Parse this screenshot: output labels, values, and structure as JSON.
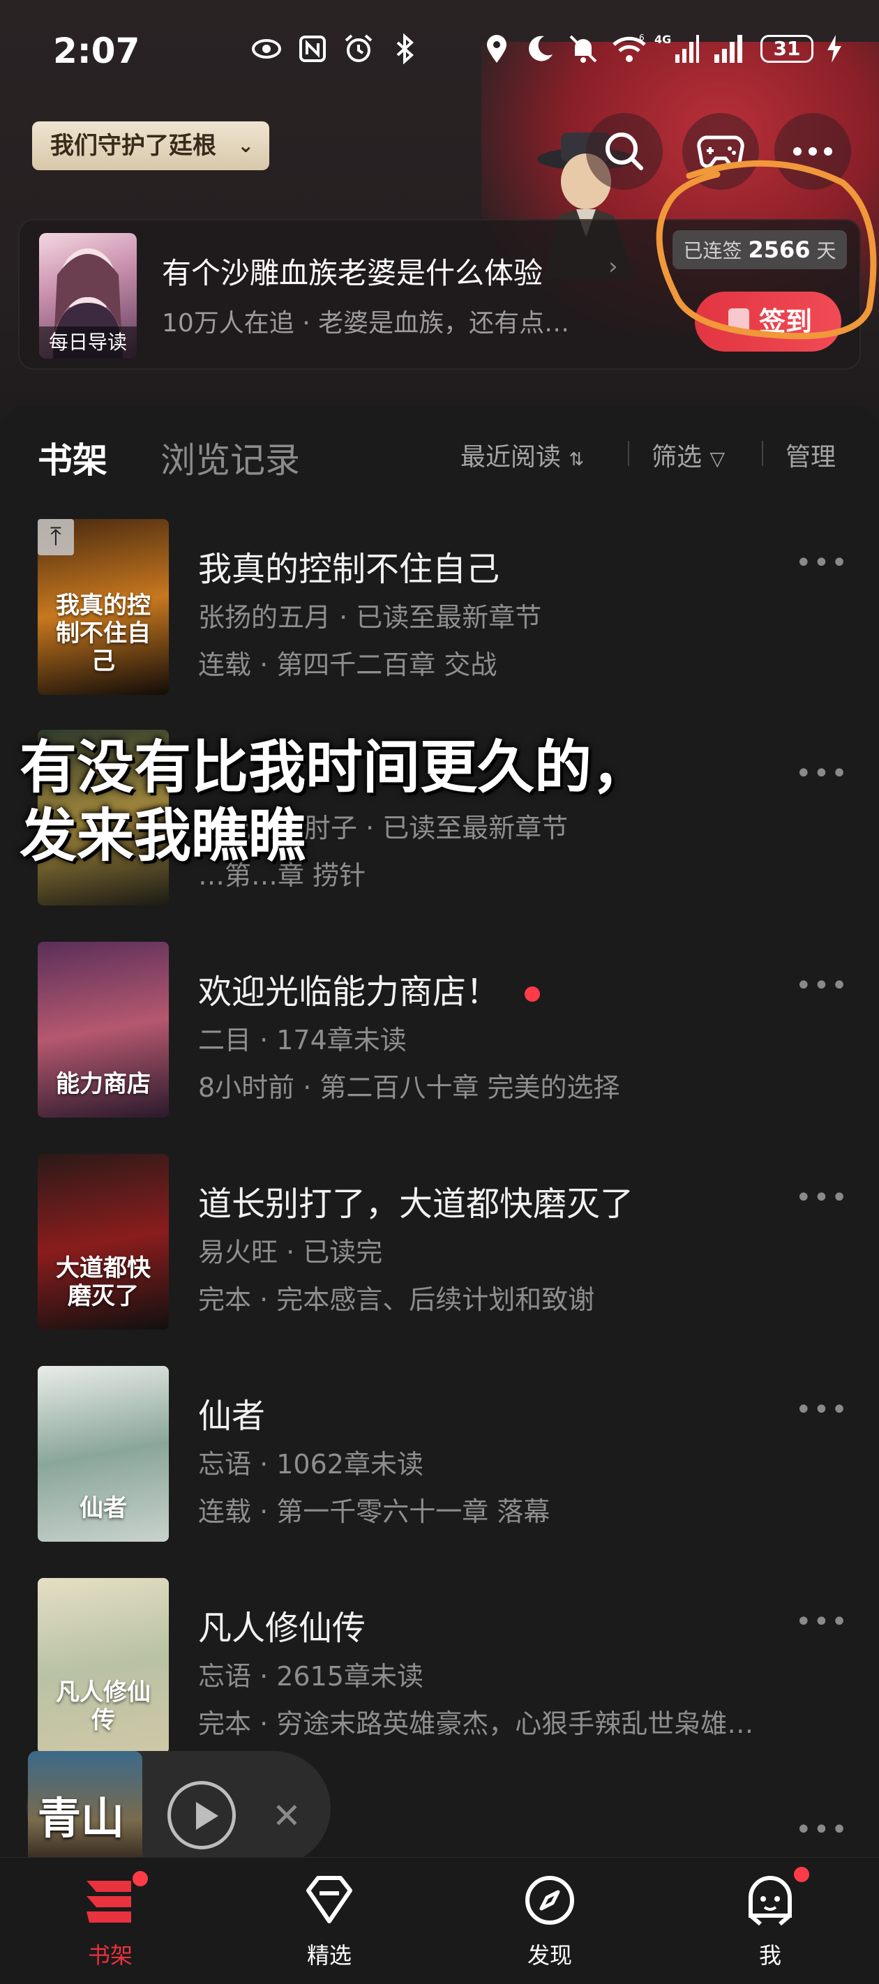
{
  "status": {
    "time": "2:07",
    "battery": "31",
    "network_label": "4G",
    "wifi_badge": "6"
  },
  "header": {
    "guard_chip": "我们守护了廷根",
    "icons": [
      "search-icon",
      "gamepad-icon",
      "more-icon"
    ]
  },
  "daily": {
    "cover_label": "每日导读",
    "title": "有个沙雕血族老婆是什么体验",
    "meta": "10万人在追 · 老婆是血族，还有点…",
    "streak_prefix": "已连签",
    "streak_days": "2566",
    "streak_suffix": "天",
    "checkin_label": "签到"
  },
  "shelf": {
    "tabs": [
      "书架",
      "浏览记录"
    ],
    "sort_label": "最近阅读",
    "filter_label": "筛选",
    "manage_label": "管理"
  },
  "books": [
    {
      "title": "我真的控制不住自己",
      "line2": "张扬的五月 · 已读至最新章节",
      "line3": "连载 · 第四千二百章 交战",
      "cover_text": "我真的控制不住自己",
      "pinned": true,
      "new": false,
      "colors": [
        "#4a2a10",
        "#c7781f",
        "#120c08"
      ]
    },
    {
      "title": "",
      "line2": "会说话的肘子 · 已读至最新章节",
      "line3": "…第…章 捞针",
      "cover_text": "",
      "pinned": false,
      "new": false,
      "colors": [
        "#2d3a2c",
        "#a58a3d",
        "#1b1a14"
      ]
    },
    {
      "title": "欢迎光临能力商店！",
      "line2": "二目 · 174章未读",
      "line3": "8小时前 · 第二百八十章 完美的选择",
      "cover_text": "能力商店",
      "pinned": false,
      "new": true,
      "colors": [
        "#5a2f5a",
        "#b5586f",
        "#2b1a2c"
      ]
    },
    {
      "title": "道长别打了，大道都快磨灭了",
      "line2": "易火旺 · 已读完",
      "line3": "完本 · 完本感言、后续计划和致谢",
      "cover_text": "大道都快磨灭了",
      "pinned": false,
      "new": false,
      "colors": [
        "#2a1a18",
        "#8a1d1d",
        "#121010"
      ]
    },
    {
      "title": "仙者",
      "line2": "忘语 · 1062章未读",
      "line3": "连载 · 第一千零六十一章 落幕",
      "cover_text": "仙者",
      "pinned": false,
      "new": false,
      "colors": [
        "#e9ece8",
        "#8aa69a",
        "#c8d2cc"
      ]
    },
    {
      "title": "凡人修仙传",
      "line2": "忘语 · 2615章未读",
      "line3": "完本 · 穷途末路英雄豪杰，心狠手辣乱世枭雄…",
      "cover_text": "凡人修仙传",
      "pinned": false,
      "new": false,
      "colors": [
        "#e5dfc4",
        "#b9c2a4",
        "#cfc8a6"
      ]
    }
  ],
  "overlay_caption": [
    "有没有比我时间更久的，",
    "发来我瞧瞧"
  ],
  "mini_player": {
    "cover_text": "青山"
  },
  "nav": [
    {
      "label": "书架",
      "icon": "bookshelf-icon",
      "active": true
    },
    {
      "label": "精选",
      "icon": "diamond-icon",
      "active": false
    },
    {
      "label": "发现",
      "icon": "compass-icon",
      "active": false
    },
    {
      "label": "我",
      "icon": "profile-icon",
      "active": false
    }
  ],
  "colors": {
    "accent": "#e8323e",
    "background": "#1b1b1b",
    "annotation": "#f0983a"
  }
}
